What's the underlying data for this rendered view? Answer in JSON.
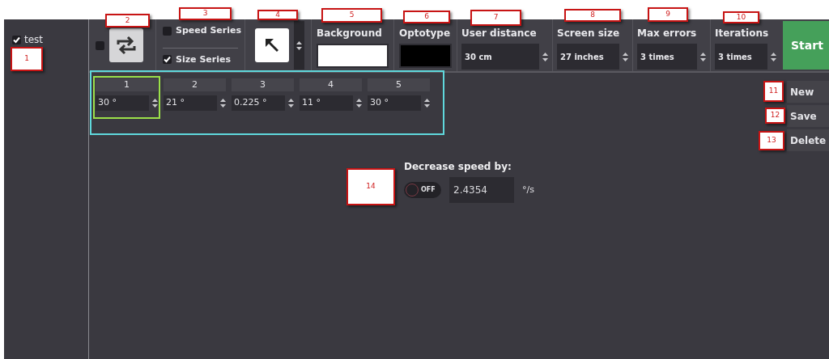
{
  "sidebar": {
    "items": [
      {
        "label": "test",
        "checked": true
      }
    ]
  },
  "toolbar": {
    "repeat": {
      "checked": false
    },
    "series": [
      {
        "label": "Speed Series",
        "checked": false
      },
      {
        "label": "Size Series",
        "checked": true
      }
    ],
    "color_settings": [
      {
        "label": "Background",
        "color": "#ffffff"
      },
      {
        "label": "Optotype",
        "color": "#000000"
      }
    ],
    "fields": [
      {
        "label": "User distance",
        "value": "30 cm"
      },
      {
        "label": "Screen size",
        "value": "27 inches"
      },
      {
        "label": "Max errors",
        "value": "3 times"
      },
      {
        "label": "Iterations",
        "value": "3 times"
      }
    ],
    "start_button": "Start"
  },
  "series_table": [
    {
      "header": "1",
      "value": "30 °",
      "selected": true
    },
    {
      "header": "2",
      "value": "21 °",
      "selected": false
    },
    {
      "header": "3",
      "value": "0.225 °",
      "selected": false
    },
    {
      "header": "4",
      "value": "11 °",
      "selected": false
    },
    {
      "header": "5",
      "value": "30 °",
      "selected": false
    }
  ],
  "actions": [
    "New",
    "Save",
    "Delete"
  ],
  "decrease_speed": {
    "label": "Decrease speed by:",
    "toggle": {
      "on": false,
      "label": "OFF"
    },
    "value": "2.4354",
    "unit": "°/s"
  },
  "callouts": [
    "1",
    "2",
    "3",
    "4",
    "5",
    "6",
    "7",
    "8",
    "9",
    "10",
    "11",
    "12",
    "13",
    "14"
  ]
}
